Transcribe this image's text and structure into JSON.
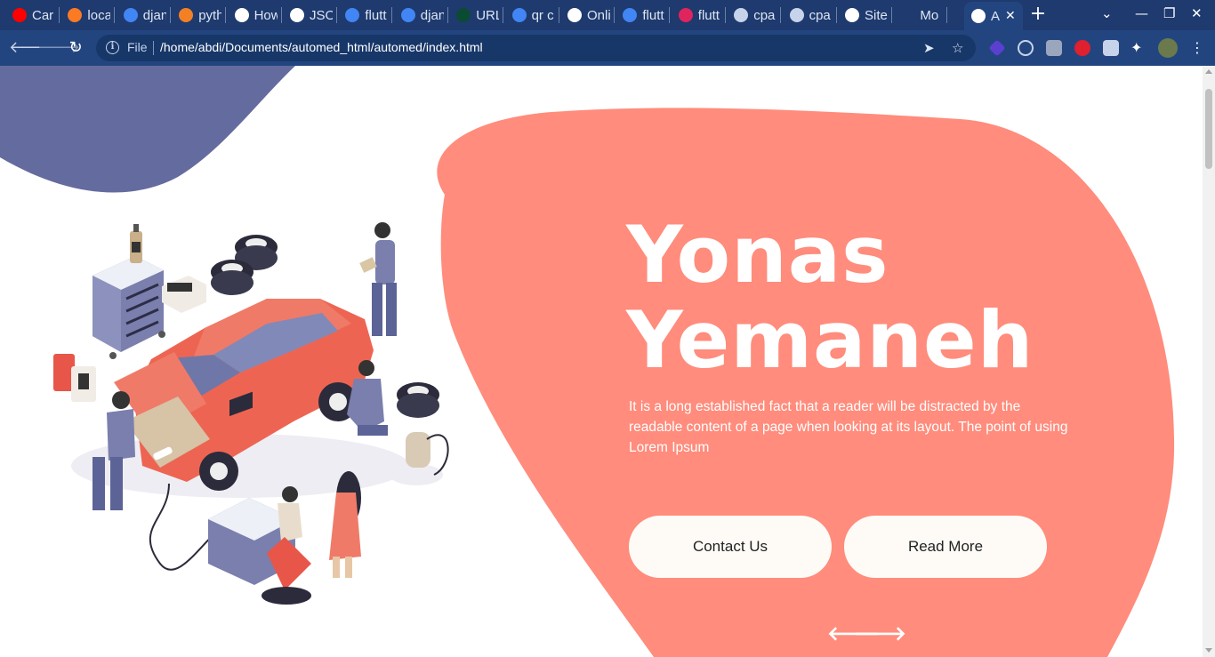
{
  "browser": {
    "tabs": [
      {
        "title": "Car",
        "icon": "youtube-icon",
        "color": "#ff0000"
      },
      {
        "title": "loca",
        "icon": "xampp-icon",
        "color": "#fb7a24"
      },
      {
        "title": "djan",
        "icon": "google-icon",
        "color": "#4285f4"
      },
      {
        "title": "pyth",
        "icon": "stackoverflow-icon",
        "color": "#f48024"
      },
      {
        "title": "How",
        "icon": "globe-icon",
        "color": "#ffffff"
      },
      {
        "title": "JSO",
        "icon": "globe-icon",
        "color": "#ffffff"
      },
      {
        "title": "flutt",
        "icon": "google-icon",
        "color": "#4285f4"
      },
      {
        "title": "djan",
        "icon": "google-icon",
        "color": "#4285f4"
      },
      {
        "title": "URL",
        "icon": "django-icon",
        "color": "#0c4b33"
      },
      {
        "title": "qr c",
        "icon": "google-icon",
        "color": "#4285f4"
      },
      {
        "title": "Onli",
        "icon": "qr-icon",
        "color": "#ffffff"
      },
      {
        "title": "flutt",
        "icon": "google-icon",
        "color": "#4285f4"
      },
      {
        "title": "flutt",
        "icon": "rose-icon",
        "color": "#e0245e"
      },
      {
        "title": "cpa",
        "icon": "link-icon",
        "color": "#c7d3ea"
      },
      {
        "title": "cpa",
        "icon": "link-icon",
        "color": "#c7d3ea"
      },
      {
        "title": "Site",
        "icon": "globe-icon",
        "color": "#ffffff"
      },
      {
        "title": "Mo",
        "icon": "blank-icon",
        "color": "#1e3a6e"
      }
    ],
    "active_tab": {
      "title": "A",
      "icon": "globe-icon"
    },
    "new_tab_label": "+",
    "omnibox": {
      "scheme": "File",
      "url": "/home/abdi/Documents/automed_html/automed/index.html"
    }
  },
  "hero": {
    "name_line1": "Yonas",
    "name_line2": "Yemaneh",
    "description": "It is a long established fact that a reader will be distracted by the readable content of a page when looking at its layout. The point of using Lorem Ipsum",
    "contact_label": "Contact Us",
    "read_more_label": "Read More",
    "prev_arrow": "🡐",
    "next_arrow": "🡒"
  },
  "colors": {
    "blob": "#ff8c7c",
    "corner_blob": "#646b9e",
    "browser_frame": "#1e3a6e",
    "toolbar": "#23457f"
  }
}
